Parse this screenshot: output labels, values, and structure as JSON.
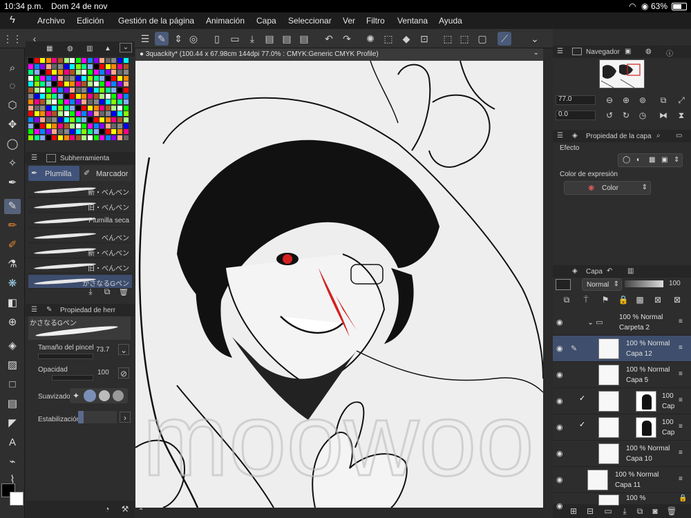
{
  "status": {
    "time": "10:34 p.m.",
    "date": "Dom 24 de nov",
    "battery": "63%",
    "wifi_icon": "wifi-icon",
    "battery_icon": "battery-icon"
  },
  "menu": {
    "items": [
      "Archivo",
      "Edición",
      "Gestión de la página",
      "Animación",
      "Capa",
      "Seleccionar",
      "Ver",
      "Filtro",
      "Ventana",
      "Ayuda"
    ]
  },
  "document": {
    "tab_title": "3quackity* (100.44 x 67.98cm 144dpi 77.0% : CMYK:Generic CMYK Profile)"
  },
  "subtool": {
    "header": "Subherramienta",
    "tabs": [
      "Plumilla",
      "Marcador"
    ],
    "brushes": [
      "新・べんべン",
      "旧・べんベン",
      "Plumilla seca",
      "べんべン",
      "新・べんべン",
      "旧・べんべン",
      "かさなるGペン"
    ],
    "active_index": 6
  },
  "tool_property": {
    "header": "Propiedad de herr",
    "brush_name": "かさなるGペン",
    "size_label": "Tamaño del pincel",
    "size_value": "73.7",
    "opacity_label": "Opacidad",
    "opacity_value": "100",
    "smoothing_label": "Suavizado",
    "stabilization_label": "Estabilización"
  },
  "navigator": {
    "header": "Navegador",
    "zoom": "77.0",
    "rotation": "0.0"
  },
  "layer_property": {
    "header": "Propiedad de la capa",
    "effect_label": "Efecto",
    "expression_label": "Color de expresión",
    "expression_value": "Color"
  },
  "layers_panel": {
    "header": "Capa",
    "blend_mode": "Normal",
    "opacity": "100",
    "layers": [
      {
        "pct": "100 %",
        "mode": "Normal",
        "name": "Carpeta 2"
      },
      {
        "pct": "100 %",
        "mode": "Normal",
        "name": "Capa 12"
      },
      {
        "pct": "100 %",
        "mode": "Normal",
        "name": "Capa 5"
      },
      {
        "pct": "100",
        "mode": "",
        "name": "Cap"
      },
      {
        "pct": "100",
        "mode": "",
        "name": "Cap"
      },
      {
        "pct": "100 %",
        "mode": "Normal",
        "name": "Capa 10"
      },
      {
        "pct": "100 %",
        "mode": "Normal",
        "name": "Capa 11"
      },
      {
        "pct": "100 %",
        "mode": "",
        "name": ""
      }
    ],
    "active_index": 1
  },
  "colors": {
    "accent": "#4a5a78",
    "panel": "#2d2d2d",
    "eye_red": "#d42020"
  }
}
